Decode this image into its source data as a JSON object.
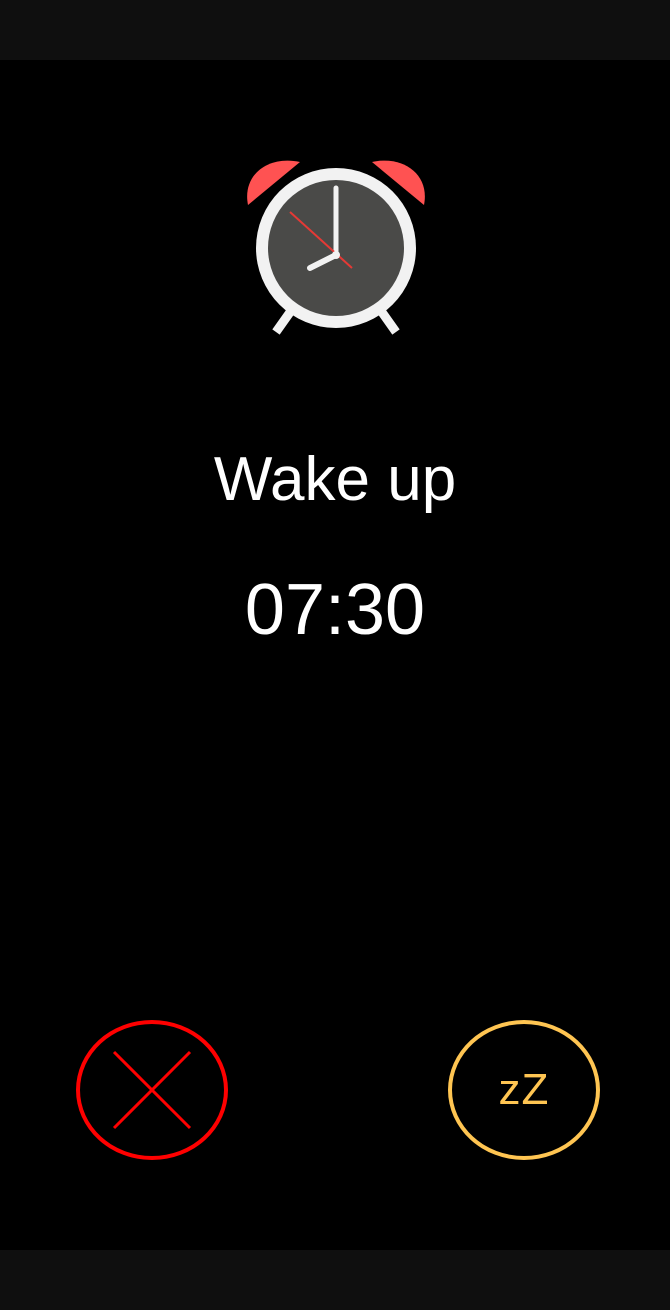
{
  "alarm": {
    "label": "Wake up",
    "time": "07:30"
  },
  "actions": {
    "dismiss_icon": "close-x-icon",
    "snooze_label": "zZ"
  },
  "colors": {
    "background": "#000000",
    "system_bars": "#0f0f0f",
    "dismiss": "#ff0000",
    "snooze": "#ffc552",
    "clock_bells": "#ff5252",
    "clock_rim": "#f2f2f2",
    "clock_face": "#4a4a48",
    "second_hand": "#e53935"
  }
}
